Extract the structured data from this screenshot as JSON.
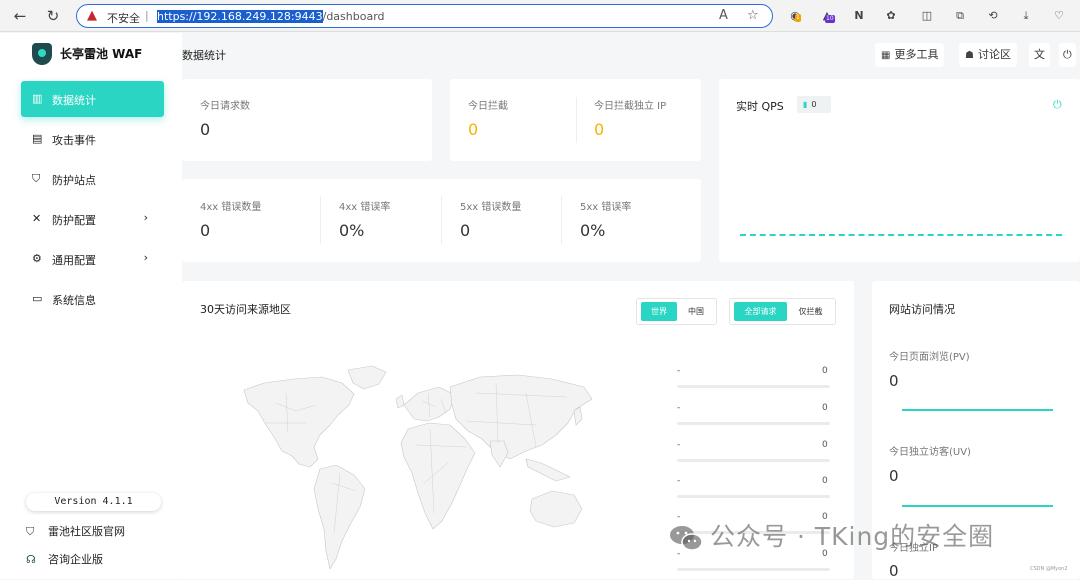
{
  "browser": {
    "security_label": "不安全",
    "separator": "|",
    "url_selected": "https://192.168.249.128:9443",
    "url_rest": "/dashboard",
    "ext_badge_1": "1",
    "ext_badge_10": "10"
  },
  "sidebar": {
    "logo_text": "长亭雷池 WAF",
    "items": [
      {
        "label": "数据统计",
        "icon": "bar-chart-icon"
      },
      {
        "label": "攻击事件",
        "icon": "document-icon"
      },
      {
        "label": "防护站点",
        "icon": "shield-icon"
      },
      {
        "label": "防护配置",
        "icon": "tools-icon",
        "arrow": "›"
      },
      {
        "label": "通用配置",
        "icon": "settings-icon",
        "arrow": "›"
      },
      {
        "label": "系统信息",
        "icon": "monitor-icon"
      }
    ],
    "version": "Version 4.1.1",
    "footer_links": [
      "雷池社区版官网",
      "咨询企业版"
    ]
  },
  "header": {
    "title": "数据统计",
    "buttons": [
      "更多工具",
      "讨论区"
    ]
  },
  "stats": {
    "requests_label": "今日请求数",
    "requests_value": "0",
    "blocked_label": "今日拦截",
    "blocked_value": "0",
    "blocked_ip_label": "今日拦截独立 IP",
    "blocked_ip_value": "0",
    "errors": [
      {
        "label": "4xx 错误数量",
        "value": "0"
      },
      {
        "label": "4xx 错误率",
        "value": "0%"
      },
      {
        "label": "5xx 错误数量",
        "value": "0"
      },
      {
        "label": "5xx 错误率",
        "value": "0%"
      }
    ]
  },
  "qps": {
    "title": "实时 QPS",
    "badge_value": "0"
  },
  "map_card": {
    "title": "30天访问来源地区",
    "region_toggle": [
      "世界",
      "中国"
    ],
    "filter_toggle": [
      "全部请求",
      "仅拦截"
    ],
    "ranks": [
      {
        "label": "-",
        "value": "0"
      },
      {
        "label": "-",
        "value": "0"
      },
      {
        "label": "-",
        "value": "0"
      },
      {
        "label": "-",
        "value": "0"
      },
      {
        "label": "-",
        "value": "0"
      },
      {
        "label": "-",
        "value": "0"
      }
    ]
  },
  "site_card": {
    "title": "网站访问情况",
    "pv_label": "今日页面浏览(PV)",
    "pv_value": "0",
    "uv_label": "今日独立访客(UV)",
    "uv_value": "0",
    "third_label": "今日独立IP",
    "third_value": "0"
  },
  "overlay": {
    "watermark": "公众号 · TKing的安全圈",
    "credit": "CSDN @Myon⁠2"
  },
  "colors": {
    "accent": "#2ad6c3",
    "warning": "#f5b400",
    "brand_dark": "#1f4b4f"
  }
}
